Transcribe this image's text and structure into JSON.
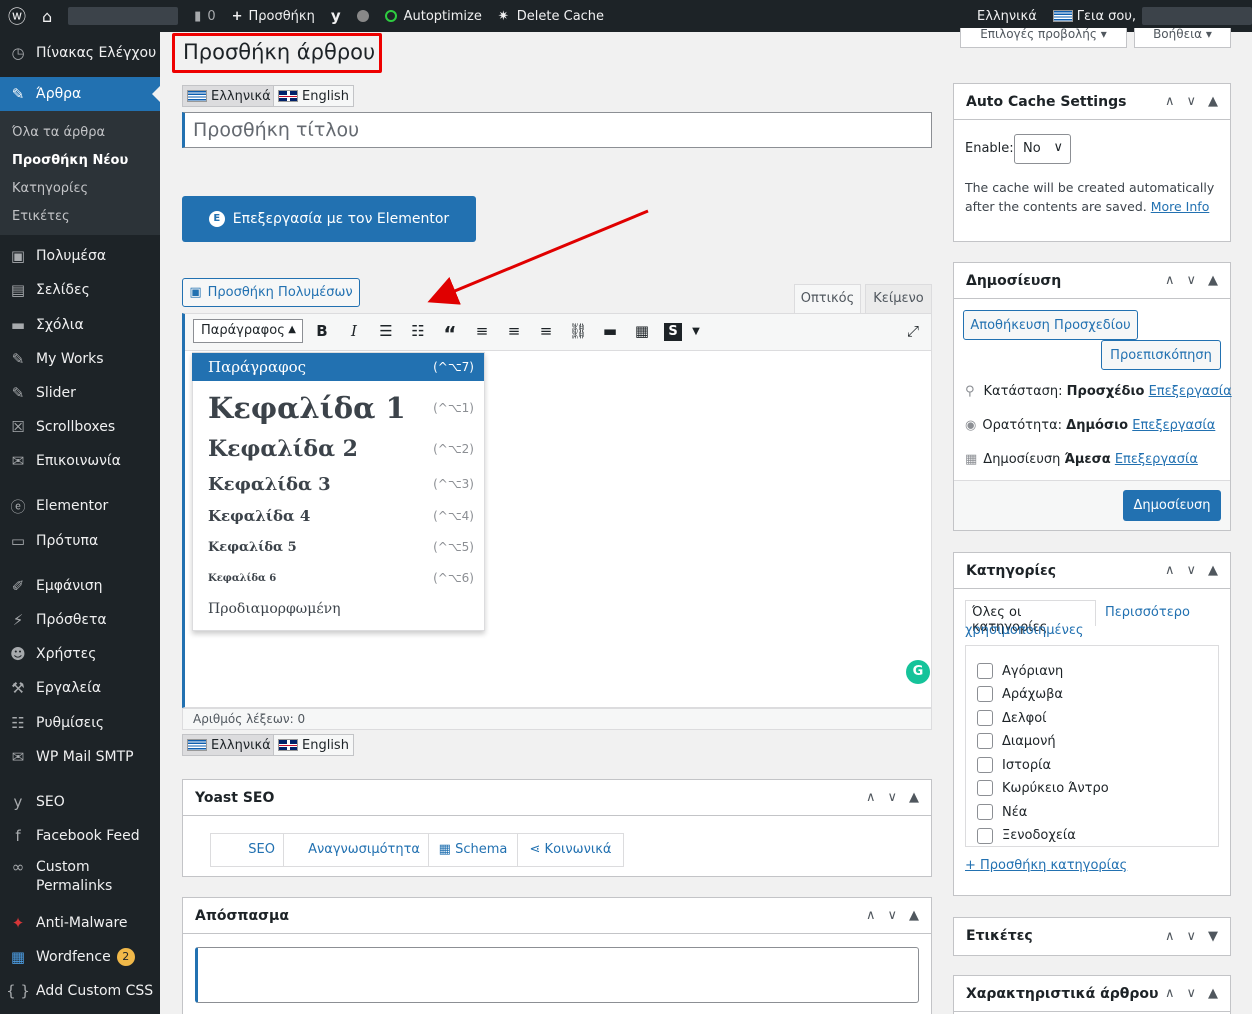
{
  "adminbar": {
    "comments_count": "0",
    "add_new": "Προσθήκη",
    "autoptimize": "Autoptimize",
    "delete_cache": "Delete Cache",
    "language": "Ελληνικά",
    "greeting": "Γεια σου,"
  },
  "sidebar": {
    "items": [
      "Πίνακας Ελέγχου",
      "Άρθρα",
      "Πολυμέσα",
      "Σελίδες",
      "Σχόλια",
      "My Works",
      "Slider",
      "Scrollboxes",
      "Επικοινωνία",
      "Elementor",
      "Πρότυπα",
      "Εμφάνιση",
      "Πρόσθετα",
      "Χρήστες",
      "Εργαλεία",
      "Ρυθμίσεις",
      "WP Mail SMTP",
      "SEO",
      "Facebook Feed",
      "Custom Permalinks",
      "Anti-Malware",
      "Wordfence",
      "Add Custom CSS"
    ],
    "submenu": [
      "Όλα τα άρθρα",
      "Προσθήκη Νέου",
      "Κατηγορίες",
      "Ετικέτες"
    ],
    "wordfence_badge": "2"
  },
  "screen_options": "Επιλογές προβολής",
  "help": "Βοήθεια",
  "page_title": "Προσθήκη άρθρου",
  "lang_tabs": [
    "Ελληνικά",
    "English"
  ],
  "title_placeholder": "Προσθήκη τίτλου",
  "elementor_button": "Επεξεργασία με τον Elementor",
  "add_media": "Προσθήκη Πολυμέσων",
  "editor_tabs": [
    "Οπτικός",
    "Κείμενο"
  ],
  "format_select": "Παράγραφος",
  "format_menu": [
    {
      "label": "Παράγραφος",
      "shortcut": "(^⌥7)"
    },
    {
      "label": "Κεφαλίδα 1",
      "shortcut": "(^⌥1)"
    },
    {
      "label": "Κεφαλίδα 2",
      "shortcut": "(^⌥2)"
    },
    {
      "label": "Κεφαλίδα 3",
      "shortcut": "(^⌥3)"
    },
    {
      "label": "Κεφαλίδα 4",
      "shortcut": "(^⌥4)"
    },
    {
      "label": "Κεφαλίδα 5",
      "shortcut": "(^⌥5)"
    },
    {
      "label": "Κεφαλίδα 6",
      "shortcut": "(^⌥6)"
    },
    {
      "label": "Προδιαμορφωμένη",
      "shortcut": ""
    }
  ],
  "word_count": "Αριθμός λέξεων: 0",
  "yoast": {
    "title": "Yoast SEO",
    "tabs": [
      "SEO",
      "Αναγνωσιμότητα",
      "Schema",
      "Κοινωνικά"
    ]
  },
  "excerpt_title": "Απόσπασμα",
  "auto_cache": {
    "title": "Auto Cache Settings",
    "enable_label": "Enable:",
    "enable_value": "No",
    "desc": "The cache will be created automatically after the contents are saved.",
    "more_info": "More Info"
  },
  "publish": {
    "title": "Δημοσίευση",
    "save_draft": "Αποθήκευση Προσχεδίου",
    "preview": "Προεπισκόπηση",
    "status_label": "Κατάσταση:",
    "status_value": "Προσχέδιο",
    "visibility_label": "Ορατότητα:",
    "visibility_value": "Δημόσιο",
    "publish_label": "Δημοσίευση",
    "publish_value": "Άμεσα",
    "edit": "Επεξεργασία",
    "publish_button": "Δημοσίευση"
  },
  "categories": {
    "title": "Κατηγορίες",
    "tab_all": "Όλες οι κατηγορίες",
    "tab_most": "Περισσότερο χρησιμοποιημένες",
    "items": [
      "Αγόριανη",
      "Αράχωβα",
      "Δελφοί",
      "Διαμονή",
      "Ιστορία",
      "Κωρύκειο Άντρο",
      "Νέα",
      "Ξενοδοχεία"
    ],
    "add_new": "+ Προσθήκη κατηγορίας"
  },
  "tags_title": "Ετικέτες",
  "post_features_title": "Χαρακτηριστικά άρθρου",
  "colors": {
    "accent": "#2271b1",
    "adminbar": "#1d2327",
    "annotation": "#e00000"
  }
}
